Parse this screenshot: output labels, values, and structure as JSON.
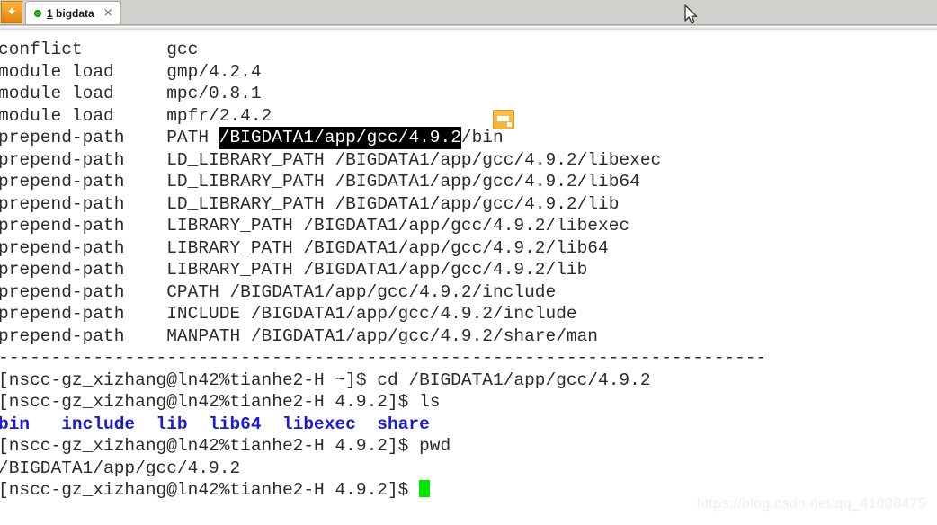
{
  "window": {
    "app_icon_glyph": "✦"
  },
  "tabbar": {
    "tab": {
      "number": "1",
      "name": "bigdata",
      "close_label": "×",
      "status_color": "#22b514"
    }
  },
  "terminal": {
    "background_color": "#ffffff",
    "foreground_color": "#2b2b2b",
    "directory_color": "#1b1bd6",
    "selection_bg": "#000000",
    "selection_fg": "#ffffff",
    "cursor_color": "#00e800",
    "lines": [
      {
        "id": "l01",
        "type": "plain",
        "text": "conflict        gcc"
      },
      {
        "id": "l02",
        "type": "plain",
        "text": "module load     gmp/4.2.4"
      },
      {
        "id": "l03",
        "type": "plain",
        "text": "module load     mpc/0.8.1"
      },
      {
        "id": "l04",
        "type": "plain",
        "text": "module load     mpfr/2.4.2"
      },
      {
        "id": "l05",
        "type": "selection",
        "pre": "prepend-path    PATH ",
        "selected": "/BIGDATA1/app/gcc/4.9.2",
        "post": "/bin"
      },
      {
        "id": "l06",
        "type": "plain",
        "text": "prepend-path    LD_LIBRARY_PATH /BIGDATA1/app/gcc/4.9.2/libexec"
      },
      {
        "id": "l07",
        "type": "plain",
        "text": "prepend-path    LD_LIBRARY_PATH /BIGDATA1/app/gcc/4.9.2/lib64"
      },
      {
        "id": "l08",
        "type": "plain",
        "text": "prepend-path    LD_LIBRARY_PATH /BIGDATA1/app/gcc/4.9.2/lib"
      },
      {
        "id": "l09",
        "type": "plain",
        "text": "prepend-path    LIBRARY_PATH /BIGDATA1/app/gcc/4.9.2/libexec"
      },
      {
        "id": "l10",
        "type": "plain",
        "text": "prepend-path    LIBRARY_PATH /BIGDATA1/app/gcc/4.9.2/lib64"
      },
      {
        "id": "l11",
        "type": "plain",
        "text": "prepend-path    LIBRARY_PATH /BIGDATA1/app/gcc/4.9.2/lib"
      },
      {
        "id": "l12",
        "type": "plain",
        "text": "prepend-path    CPATH /BIGDATA1/app/gcc/4.9.2/include"
      },
      {
        "id": "l13",
        "type": "plain",
        "text": "prepend-path    INCLUDE /BIGDATA1/app/gcc/4.9.2/include"
      },
      {
        "id": "l14",
        "type": "plain",
        "text": "prepend-path    MANPATH /BIGDATA1/app/gcc/4.9.2/share/man"
      },
      {
        "id": "l15",
        "type": "plain",
        "text": "-------------------------------------------------------------------------"
      },
      {
        "id": "l16",
        "type": "plain",
        "text": "[nscc-gz_xizhang@ln42%tianhe2-H ~]$ cd /BIGDATA1/app/gcc/4.9.2"
      },
      {
        "id": "l17",
        "type": "plain",
        "text": "[nscc-gz_xizhang@ln42%tianhe2-H 4.9.2]$ ls"
      },
      {
        "id": "l18",
        "type": "dirlist",
        "text": "bin   include  lib  lib64  libexec  share"
      },
      {
        "id": "l19",
        "type": "plain",
        "text": "[nscc-gz_xizhang@ln42%tianhe2-H 4.9.2]$ pwd"
      },
      {
        "id": "l20",
        "type": "plain",
        "text": "/BIGDATA1/app/gcc/4.9.2"
      },
      {
        "id": "l21",
        "type": "prompt-cursor",
        "text": "[nscc-gz_xizhang@ln42%tianhe2-H 4.9.2]$ "
      }
    ]
  },
  "overlay": {
    "drag_icon_name": "drag-copy-icon",
    "watermark": "https://blog.csdn.net/qq_41088475"
  }
}
